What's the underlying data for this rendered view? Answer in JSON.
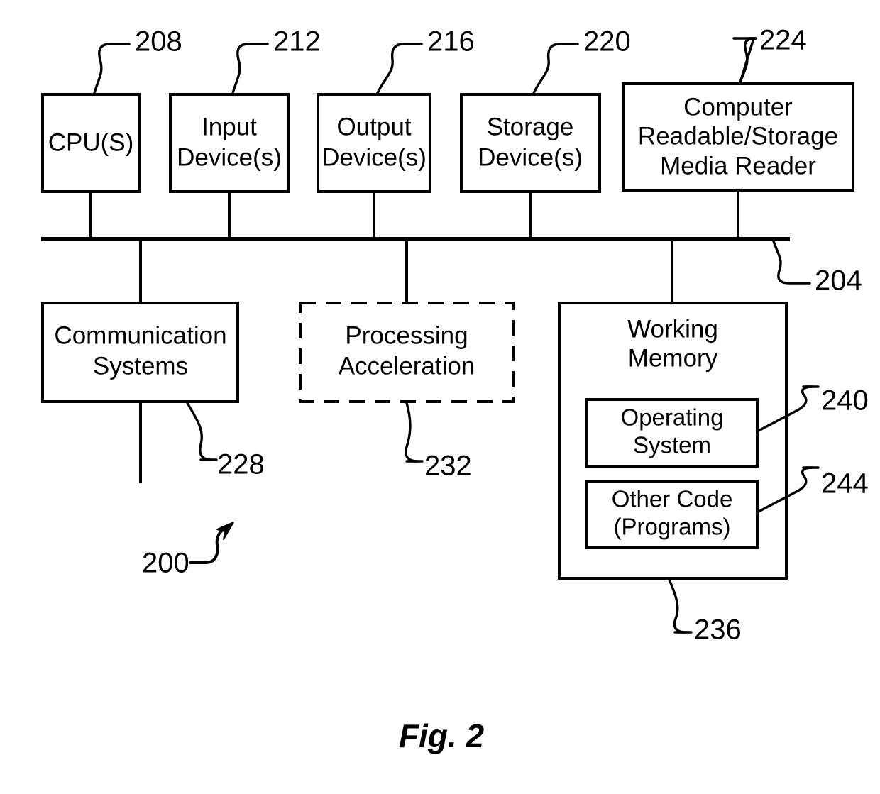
{
  "figure": {
    "caption": "Fig. 2",
    "system_ref": "200",
    "bus_ref": "204"
  },
  "top_row": [
    {
      "name": "cpu",
      "ref": "208",
      "lines": [
        "CPU(S)"
      ]
    },
    {
      "name": "input-devices",
      "ref": "212",
      "lines": [
        "Input",
        "Device(s)"
      ]
    },
    {
      "name": "output-devices",
      "ref": "216",
      "lines": [
        "Output",
        "Device(s)"
      ]
    },
    {
      "name": "storage-devices",
      "ref": "220",
      "lines": [
        "Storage",
        "Device(s)"
      ]
    },
    {
      "name": "media-reader",
      "ref": "224",
      "lines": [
        "Computer",
        "Readable/Storage",
        "Media Reader"
      ]
    }
  ],
  "bottom_row": [
    {
      "name": "communication-systems",
      "ref": "228",
      "lines": [
        "Communication",
        "Systems"
      ],
      "style": "solid"
    },
    {
      "name": "processing-acceleration",
      "ref": "232",
      "lines": [
        "Processing",
        "Acceleration"
      ],
      "style": "dashed"
    },
    {
      "name": "working-memory",
      "ref": "236",
      "lines": [
        "Working",
        "Memory"
      ],
      "style": "solid"
    }
  ],
  "working_memory_children": [
    {
      "name": "operating-system",
      "ref": "240",
      "lines": [
        "Operating",
        "System"
      ]
    },
    {
      "name": "other-code",
      "ref": "244",
      "lines": [
        "Other Code",
        "(Programs)"
      ]
    }
  ]
}
